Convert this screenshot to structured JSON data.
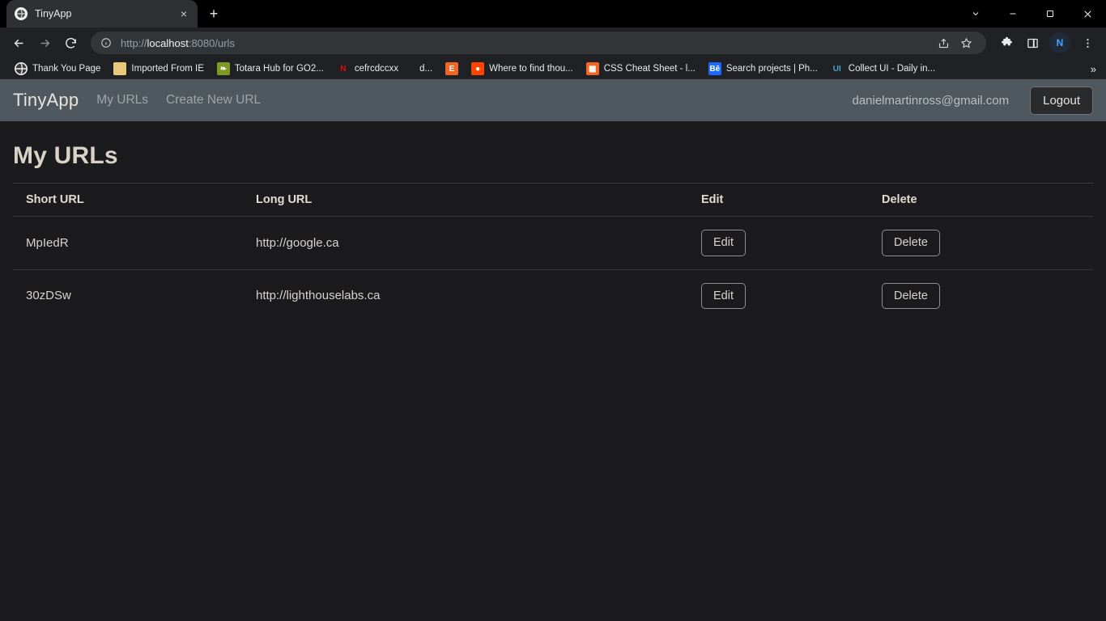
{
  "browser": {
    "tab": {
      "title": "TinyApp",
      "favicon": "globe-icon",
      "close": "×"
    },
    "newtab_label": "+",
    "window_controls": [
      "tab-search-chevron",
      "minimize",
      "maximize",
      "close"
    ],
    "toolbar": {
      "back": "back-arrow",
      "forward": "forward-arrow",
      "reload": "reload-icon",
      "site_info": "info-circle-icon",
      "url_scheme": "http://",
      "url_host": "localhost",
      "url_rest": ":8080/urls",
      "url_full": "http://localhost:8080/urls",
      "share": "share-icon",
      "bookmark": "star-icon",
      "extensions": "puzzle-icon",
      "side_panel": "side-panel-icon",
      "profile_initial": "N",
      "menu": "three-dot-menu-icon"
    },
    "bookmarks": [
      {
        "label": "Thank You Page",
        "icon": "globe-icon",
        "icon_bg": "#f1f1f1",
        "icon_fg": "#2b2b2b",
        "glyph": ""
      },
      {
        "label": "Imported From IE",
        "icon": "folder-icon",
        "icon_bg": "#e8c87a",
        "icon_fg": "#6b5320",
        "glyph": ""
      },
      {
        "label": "Totara Hub for GO2...",
        "icon": "totara-icon",
        "icon_bg": "#7f9a24",
        "icon_fg": "#ffffff",
        "glyph": "❧"
      },
      {
        "label": "cefrcdccxx",
        "icon": "netflix-icon",
        "icon_bg": "transparent",
        "icon_fg": "#e50914",
        "glyph": "N"
      },
      {
        "label": "d...",
        "icon": "blank-icon",
        "icon_bg": "transparent",
        "icon_fg": "#e8eaed",
        "glyph": ""
      },
      {
        "label": "",
        "icon": "e-icon",
        "icon_bg": "#f26522",
        "icon_fg": "#ffffff",
        "glyph": "E"
      },
      {
        "label": "Where to find thou...",
        "icon": "reddit-icon",
        "icon_bg": "#ff4500",
        "icon_fg": "#ffffff",
        "glyph": "●"
      },
      {
        "label": "CSS Cheat Sheet - l...",
        "icon": "css-tricks-icon",
        "icon_bg": "#f26522",
        "icon_fg": "#ffffff",
        "glyph": "▦"
      },
      {
        "label": "Search projects | Ph...",
        "icon": "behance-icon",
        "icon_bg": "#1769ff",
        "icon_fg": "#ffffff",
        "glyph": "Bē"
      },
      {
        "label": "Collect UI - Daily in...",
        "icon": "collectui-icon",
        "icon_bg": "transparent",
        "icon_fg": "#4aa3c7",
        "glyph": "UI"
      }
    ],
    "bookmarks_overflow": "»"
  },
  "app": {
    "brand": "TinyApp",
    "nav_links": [
      {
        "label": "My URLs"
      },
      {
        "label": "Create New URL"
      }
    ],
    "user_email": "danielmartinross@gmail.com",
    "logout_label": "Logout",
    "page_title": "My URLs",
    "table": {
      "headers": [
        "Short URL",
        "Long URL",
        "Edit",
        "Delete"
      ],
      "rows": [
        {
          "short": "MpIedR",
          "long": "http://google.ca",
          "edit": "Edit",
          "delete": "Delete"
        },
        {
          "short": "30zDSw",
          "long": "http://lighthouselabs.ca",
          "edit": "Edit",
          "delete": "Delete"
        }
      ]
    }
  },
  "colors": {
    "chrome_bg": "#202124",
    "titlebar_bg": "#000000",
    "tab_bg": "#2f3033",
    "navbar_bg": "#4e585e",
    "page_bg": "#1b1b1d",
    "accent_text": "#d9d2c8"
  }
}
